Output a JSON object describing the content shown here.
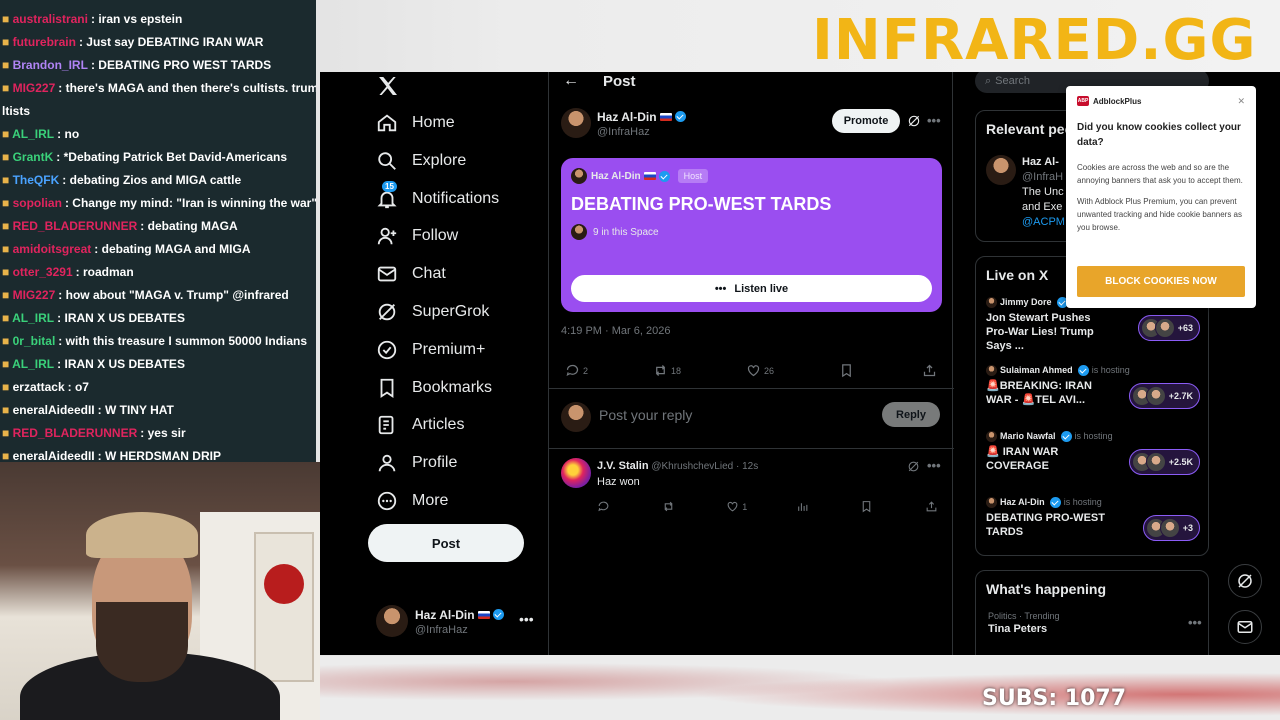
{
  "overlay": {
    "watermark": "INFRARED.GG",
    "subs": "SUBS: 1077"
  },
  "chat": [
    {
      "user": "australistrani",
      "color": "#e0245e",
      "text": "iran vs epstein"
    },
    {
      "user": "futurebrain",
      "color": "#e0245e",
      "text": "Just say DEBATING IRAN WAR"
    },
    {
      "user": "Brandon_IRL",
      "color": "#b084f5",
      "text": "DEBATING PRO WEST TARDS"
    },
    {
      "user": "MIG227",
      "color": "#e0245e",
      "text": "there's MAGA and then there's cultists. trump"
    },
    {
      "user": "",
      "color": "#fff",
      "text": "ltists"
    },
    {
      "user": "AL_IRL",
      "color": "#3ad17a",
      "text": "no"
    },
    {
      "user": "GrantK",
      "color": "#3ad17a",
      "text": "*Debating Patrick Bet David-Americans"
    },
    {
      "user": "TheQFK",
      "color": "#4aa3ff",
      "text": "debating Zios and MIGA cattle"
    },
    {
      "user": "sopolian",
      "color": "#e0245e",
      "text": "Change my mind: \"Iran is winning the war\""
    },
    {
      "user": "RED_BLADERUNNER",
      "color": "#e0245e",
      "text": "debating MAGA"
    },
    {
      "user": "amidoitsgreat",
      "color": "#e0245e",
      "text": "debating MAGA and MIGA"
    },
    {
      "user": "otter_3291",
      "color": "#e0245e",
      "text": "roadman"
    },
    {
      "user": "MIG227",
      "color": "#e0245e",
      "text": "how about \"MAGA v. Trump\" @infrared"
    },
    {
      "user": "AL_IRL",
      "color": "#3ad17a",
      "text": "IRAN X US DEBATES"
    },
    {
      "user": "0r_bital",
      "color": "#3ad17a",
      "text": "with this treasure I summon 50000 Indians"
    },
    {
      "user": "AL_IRL",
      "color": "#3ad17a",
      "text": "IRAN X US DEBATES"
    },
    {
      "user": "erzattack",
      "color": "#fff",
      "text": "o7"
    },
    {
      "user": "eneralAideedII",
      "color": "#fff",
      "text": "W TINY HAT"
    },
    {
      "user": "RED_BLADERUNNER",
      "color": "#e0245e",
      "text": "yes sir"
    },
    {
      "user": "eneralAideedII",
      "color": "#fff",
      "text": "W HERDSMAN DRIP"
    }
  ],
  "nav": {
    "items": [
      {
        "label": "Home",
        "icon": "home-icon"
      },
      {
        "label": "Explore",
        "icon": "search-icon"
      },
      {
        "label": "Notifications",
        "icon": "bell-icon",
        "badge": "15"
      },
      {
        "label": "Follow",
        "icon": "person-add-icon"
      },
      {
        "label": "Chat",
        "icon": "mail-icon"
      },
      {
        "label": "SuperGrok",
        "icon": "grok-icon"
      },
      {
        "label": "Premium+",
        "icon": "verified-icon"
      },
      {
        "label": "Bookmarks",
        "icon": "bookmark-icon"
      },
      {
        "label": "Articles",
        "icon": "article-icon"
      },
      {
        "label": "Profile",
        "icon": "person-icon"
      },
      {
        "label": "More",
        "icon": "more-circle-icon"
      }
    ],
    "post_button": "Post",
    "account": {
      "name": "Haz Al-Din",
      "handle": "@InfraHaz"
    }
  },
  "main": {
    "title": "Post",
    "author": {
      "name": "Haz Al-Din",
      "handle": "@InfraHaz"
    },
    "promote": "Promote",
    "space": {
      "host": "Haz Al-Din",
      "host_tag": "Host",
      "title": "DEBATING PRO-WEST TARDS",
      "count": "9 in this Space",
      "listen": "Listen live"
    },
    "timestamp": "4:19 PM · Mar 6, 2026",
    "stats": {
      "replies": "2",
      "reposts": "18",
      "likes": "26"
    },
    "reply_placeholder": "Post your reply",
    "reply_button": "Reply",
    "comment": {
      "name": "J.V. Stalin",
      "handle": "@KhrushchevLied",
      "time": "· 12s",
      "text": "Haz won",
      "likes": "1"
    }
  },
  "side": {
    "search_placeholder": "Search",
    "relevant": {
      "title": "Relevant people",
      "name": "Haz Al-",
      "handle": "@InfraH",
      "bio1": "The Unc",
      "bio2": "and Exe",
      "link": "@ACPM"
    },
    "live": {
      "title": "Live on X",
      "items": [
        {
          "host": "Jimmy Dore",
          "status": "",
          "title": "Jon Stewart Pushes Pro-War Lies! Trump Says ...",
          "count": "+63"
        },
        {
          "host": "Sulaiman Ahmed",
          "status": "is hosting",
          "title": "🚨BREAKING: IRAN WAR - 🚨TEL AVI...",
          "count": "+2.7K"
        },
        {
          "host": "Mario Nawfal",
          "status": "is hosting",
          "title": "🚨 IRAN WAR COVERAGE",
          "count": "+2.5K"
        },
        {
          "host": "Haz Al-Din",
          "status": "is hosting",
          "title": "DEBATING PRO-WEST TARDS",
          "count": "+3"
        }
      ]
    },
    "happening": {
      "title": "What's happening",
      "category": "Politics · Trending",
      "trend": "Tina Peters"
    }
  },
  "adblock": {
    "brand": "AdblockPlus",
    "logo": "ABP",
    "question": "Did you know cookies collect your data?",
    "p1": "Cookies are across the web and so are the annoying banners that ask you to accept them.",
    "p2": "With Adblock Plus Premium, you can prevent unwanted tracking and hide cookie banners as you browse.",
    "button": "BLOCK COOKIES NOW"
  }
}
